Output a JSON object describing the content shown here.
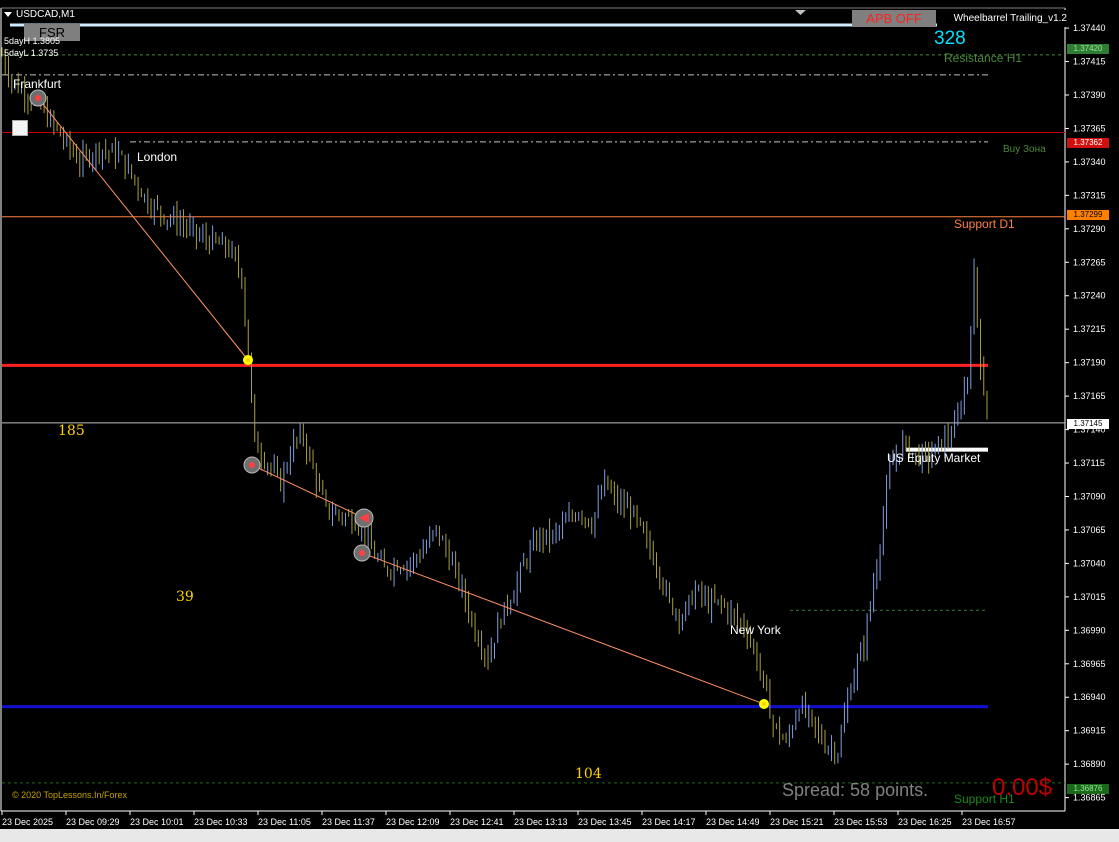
{
  "header": {
    "symbol": "USDCAD,M1",
    "fsr_button": "FSR",
    "stat_high": "5dayH 1.3805",
    "stat_low": "5dayL 1.3735",
    "apb_button": "APB OFF",
    "ea_title": "Wheelbarrel Trailing_v1.2",
    "counter": "328"
  },
  "labels": {
    "resistance_h1": "Resistance H1",
    "buy_zone": "Buy Зона",
    "support_d1": "Support D1",
    "support_h1": "Support H1",
    "us_equity": "US Equity Market",
    "frankfurt": "Frankfurt",
    "london": "London",
    "new_york": "New York",
    "num_185": "185",
    "num_39": "39",
    "num_104": "104",
    "spread": "Spread: 58 points.",
    "profit": "0.00$",
    "copyright": "© 2020 TopLessons.In/Forex"
  },
  "price_tags": {
    "resistance": "1.37420",
    "buy": "1.37362",
    "support_d1": "1.37299",
    "current": "1.37145",
    "support_h1": "1.36876"
  },
  "colors": {
    "bull": "#7f9fe0",
    "bear": "#a8a040",
    "resistance": "#4a8a3a",
    "buy_zone": "#c00000",
    "support_d1": "#ff8040",
    "red_level": "#ff2020",
    "blue_level": "#1010d0",
    "current": "#c0c0c0",
    "trend": "#ff9060"
  },
  "chart_data": {
    "type": "candlestick",
    "symbol": "USDCAD",
    "timeframe": "M1",
    "ylim": [
      1.36855,
      1.37455
    ],
    "y_ticks": [
      "1.37440",
      "1.37415",
      "1.37390",
      "1.37365",
      "1.37340",
      "1.37315",
      "1.37290",
      "1.37265",
      "1.37240",
      "1.37215",
      "1.37190",
      "1.37165",
      "1.37140",
      "1.37115",
      "1.37090",
      "1.37065",
      "1.37040",
      "1.37015",
      "1.36990",
      "1.36965",
      "1.36940",
      "1.36915",
      "1.36890",
      "1.36865"
    ],
    "x_ticks": [
      "23 Dec 2025",
      "23 Dec 09:29",
      "23 Dec 10:01",
      "23 Dec 10:33",
      "23 Dec 11:05",
      "23 Dec 11:37",
      "23 Dec 12:09",
      "23 Dec 12:41",
      "23 Dec 13:13",
      "23 Dec 13:45",
      "23 Dec 14:17",
      "23 Dec 14:49",
      "23 Dec 15:21",
      "23 Dec 15:53",
      "23 Dec 16:25",
      "23 Dec 16:57"
    ],
    "levels": {
      "resistance_h1": 1.3742,
      "buy_zone": 1.37362,
      "support_d1": 1.37299,
      "red_level": 1.37188,
      "current": 1.37145,
      "blue_level": 1.36933,
      "support_h1": 1.36876
    },
    "close_path": [
      [
        0,
        1.3742
      ],
      [
        3,
        1.374
      ],
      [
        7,
        1.37392
      ],
      [
        12,
        1.3738
      ],
      [
        18,
        1.3736
      ],
      [
        24,
        1.3734
      ],
      [
        30,
        1.3735
      ],
      [
        36,
        1.37345
      ],
      [
        40,
        1.3733
      ],
      [
        45,
        1.3731
      ],
      [
        50,
        1.373
      ],
      [
        55,
        1.37295
      ],
      [
        60,
        1.37285
      ],
      [
        65,
        1.3728
      ],
      [
        70,
        1.37275
      ],
      [
        74,
        1.37255
      ],
      [
        76,
        1.37195
      ],
      [
        78,
        1.3713
      ],
      [
        82,
        1.37115
      ],
      [
        86,
        1.371
      ],
      [
        90,
        1.3713
      ],
      [
        93,
        1.37135
      ],
      [
        96,
        1.3711
      ],
      [
        100,
        1.3708
      ],
      [
        106,
        1.37075
      ],
      [
        110,
        1.3707
      ],
      [
        114,
        1.3705
      ],
      [
        118,
        1.37035
      ],
      [
        122,
        1.3704
      ],
      [
        126,
        1.3704
      ],
      [
        130,
        1.3705
      ],
      [
        134,
        1.37065
      ],
      [
        138,
        1.37045
      ],
      [
        142,
        1.3702
      ],
      [
        146,
        1.3699
      ],
      [
        150,
        1.3697
      ],
      [
        154,
        1.37
      ],
      [
        158,
        1.3702
      ],
      [
        162,
        1.37045
      ],
      [
        166,
        1.3706
      ],
      [
        170,
        1.3706
      ],
      [
        174,
        1.3707
      ],
      [
        178,
        1.3708
      ],
      [
        182,
        1.3707
      ],
      [
        186,
        1.371
      ],
      [
        190,
        1.37085
      ],
      [
        194,
        1.3708
      ],
      [
        198,
        1.3706
      ],
      [
        202,
        1.3704
      ],
      [
        206,
        1.3701
      ],
      [
        210,
        1.37
      ],
      [
        214,
        1.3702
      ],
      [
        218,
        1.3701
      ],
      [
        222,
        1.3701
      ],
      [
        226,
        1.37
      ],
      [
        230,
        1.3699
      ],
      [
        234,
        1.3696
      ],
      [
        238,
        1.3692
      ],
      [
        242,
        1.36905
      ],
      [
        246,
        1.36935
      ],
      [
        250,
        1.3692
      ],
      [
        254,
        1.36905
      ],
      [
        258,
        1.369
      ],
      [
        262,
        1.3695
      ],
      [
        266,
        1.3698
      ],
      [
        270,
        1.3704
      ],
      [
        274,
        1.3711
      ],
      [
        278,
        1.3713
      ],
      [
        282,
        1.3712
      ],
      [
        286,
        1.3712
      ],
      [
        290,
        1.3713
      ],
      [
        294,
        1.3714
      ],
      [
        298,
        1.3718
      ],
      [
        300,
        1.37255
      ],
      [
        302,
        1.3719
      ],
      [
        304,
        1.3715
      ]
    ]
  }
}
